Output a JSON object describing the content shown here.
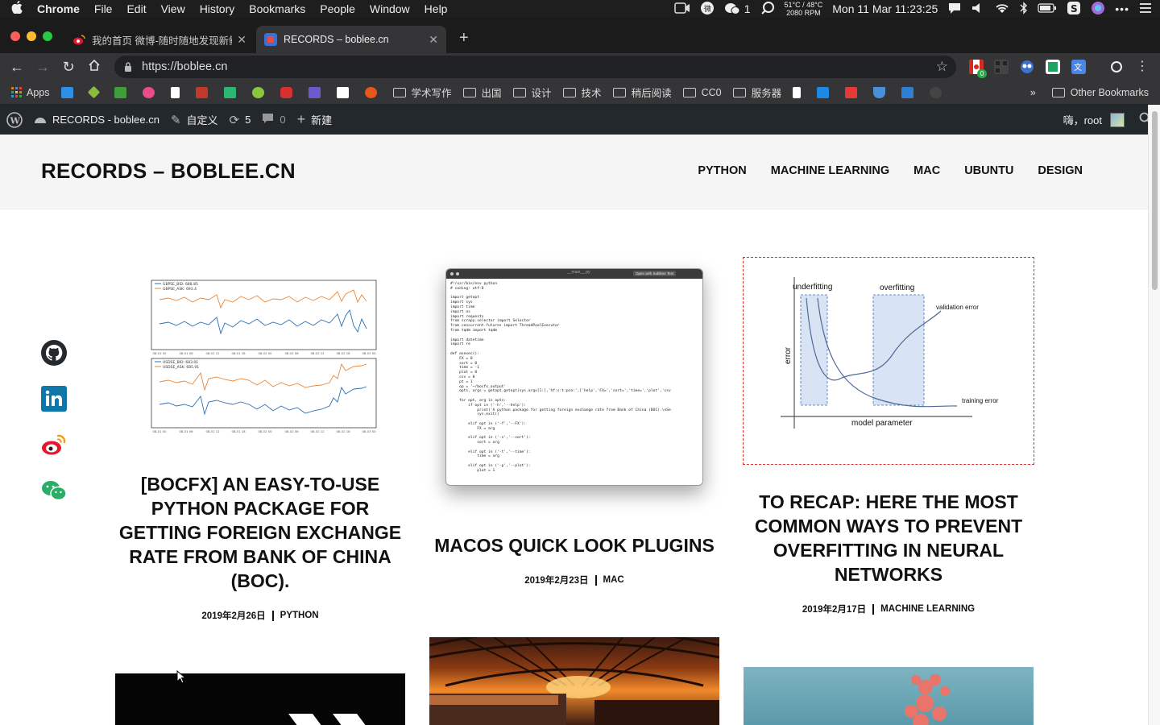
{
  "menubar": {
    "apple_icon": "apple-icon",
    "app": "Chrome",
    "items": [
      "File",
      "Edit",
      "View",
      "History",
      "Bookmarks",
      "People",
      "Window",
      "Help"
    ],
    "wechat_count": "1",
    "temp": "51°C / 48°C",
    "rpm": "2080 RPM",
    "clock": "Mon 11 Mar  11:23:25"
  },
  "tabs": [
    {
      "title": "我的首页 微博-随时随地发现新鲜事",
      "favicon_color": "#e6162d"
    },
    {
      "title": "RECORDS – boblee.cn",
      "favicon_color": "#3b6fd9"
    }
  ],
  "toolbar": {
    "url": "https://boblee.cn",
    "ext_badge": "0"
  },
  "bookmarks": {
    "apps_label": "Apps",
    "folders": [
      "学术写作",
      "出国",
      "设计",
      "技术",
      "稍后阅读",
      "CC0",
      "服务器"
    ],
    "other_label": "Other Bookmarks",
    "overflow": "»"
  },
  "wp_adminbar": {
    "site_name": "RECORDS - boblee.cn",
    "customize": "自定义",
    "updates": "5",
    "comments": "0",
    "new_label": "新建",
    "greeting": "嗨，root"
  },
  "site": {
    "brand": "RECORDS – BOBLEE.CN",
    "nav": [
      "PYTHON",
      "MACHINE LEARNING",
      "MAC",
      "UBUNTU",
      "DESIGN"
    ],
    "social": [
      "github-icon",
      "linkedin-icon",
      "weibo-icon",
      "wechat-icon"
    ]
  },
  "posts": [
    {
      "title": "[BOCFX] AN EASY-TO-USE PYTHON PACKAGE FOR GETTING FOREIGN EXCHANGE RATE FROM BANK OF CHINA (BOC).",
      "date": "2019年2月26日",
      "category": "PYTHON",
      "legend1": [
        "GBPSE_BID: 688.85",
        "GBPSE_ASK: 693.4"
      ],
      "legend2": [
        "USDSE_BID: 683.01",
        "USDSE_ASK: 685.91"
      ],
      "chart_x": [
        "08-01 00",
        "08-01 06",
        "08-01 12",
        "08-01 18",
        "08-02 00",
        "08-02 06",
        "08-02 12",
        "08-02 18",
        "08-03 00"
      ]
    },
    {
      "title": "MACOS QUICK LOOK PLUGINS",
      "date": "2019年2月23日",
      "category": "MAC",
      "window_title": "__main__.py",
      "window_button": "Open with Sublime Text",
      "code": "#!/usr/bin/env python\n# coding: utf-8\n\nimport getopt\nimport sys\nimport time\nimport os\nimport requests\nfrom scrapy.selector import Selector\nfrom concurrent.futures import ThreadPoolExecutor\nfrom tqdm import tqdm\n\nimport datetime\nimport re\n\ndef asexec():\n    FX = 0\n    sort = 0\n    time = -1\n    plot = 0\n    csv = 0\n    pt = 1\n    op = '~/bocfx_output'\n    opts, args = getopt.getopt(sys.argv[1:],'hf:s:t:pco:',['help','FX=','sort=','time=','plot','csv\n\n    for opt, arg in opts:\n        if opt in ('-h','--help'):\n            print('A python package for getting foreign exchange rate from Bank of China (BOC).\\nSe\n            sys.exit()\n\n        elif opt in ('-f','--FX'):\n            FX = arg\n\n        elif opt in ('-s','--sort'):\n            sort = arg\n\n        elif opt in ('-t','--time'):\n            time = arg\n\n        elif opt in ('-p','--plot'):\n            plot = 1"
    },
    {
      "title": "TO RECAP: HERE THE MOST COMMON WAYS TO PREVENT OVERFITTING IN NEURAL NETWORKS",
      "date": "2019年2月17日",
      "category": "MACHINE LEARNING",
      "diagram": {
        "underfitting": "underfitting",
        "overfitting": "overfitting",
        "validation": "validation error",
        "training": "training error",
        "xlabel": "model parameter",
        "ylabel": "error"
      }
    }
  ],
  "colors": {
    "accent_orange": "#e8883a",
    "accent_blue": "#2f6fb3",
    "header_bg": "#f5f5f5",
    "wp_bar": "#23282d"
  }
}
